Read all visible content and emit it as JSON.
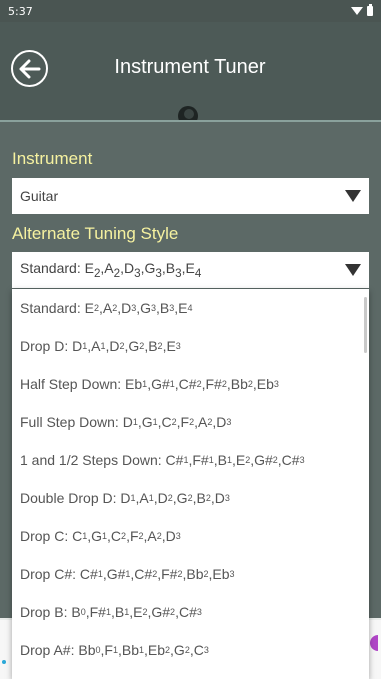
{
  "status_bar": {
    "time": "5:37"
  },
  "app_bar": {
    "title": "Instrument Tuner"
  },
  "instrument": {
    "label": "Instrument",
    "selected": "Guitar"
  },
  "tuning": {
    "label": "Alternate Tuning Style",
    "selected_html": "Standard: E<sub>2</sub>,A<sub>2</sub>,D<sub>3</sub>,G<sub>3</sub>,B<sub>3</sub>,E<sub>4</sub>",
    "options": [
      "Standard: E<sub>2</sub>,A<sub>2</sub>,D<sub>3</sub>,G<sub>3</sub>,B<sub>3</sub>,E<sub>4</sub>",
      "Drop D: D<sub>1</sub>,A<sub>1</sub>,D<sub>2</sub>,G<sub>2</sub>,B<sub>2</sub>,E<sub>3</sub>",
      "Half Step Down: Eb<sub>1</sub>,G#<sub>1</sub>,C#<sub>2</sub>,F#<sub>2</sub>,Bb<sub>2</sub>,Eb<sub>3</sub>",
      "Full Step Down: D<sub>1</sub>,G<sub>1</sub>,C<sub>2</sub>,F<sub>2</sub>,A<sub>2</sub>,D<sub>3</sub>",
      "1 and 1/2 Steps Down: C#<sub>1</sub>,F#<sub>1</sub>,B<sub>1</sub>,E<sub>2</sub>,G#<sub>2</sub>,C#<sub>3</sub>",
      "Double Drop D: D<sub>1</sub>,A<sub>1</sub>,D<sub>2</sub>,G<sub>2</sub>,B<sub>2</sub>,D<sub>3</sub>",
      "Drop C: C<sub>1</sub>,G<sub>1</sub>,C<sub>2</sub>,F<sub>2</sub>,A<sub>2</sub>,D<sub>3</sub>",
      "Drop C#: C#<sub>1</sub>,G#<sub>1</sub>,C#<sub>2</sub>,F#<sub>2</sub>,Bb<sub>2</sub>,Eb<sub>3</sub>",
      "Drop B: B<sub>0</sub>,F#<sub>1</sub>,B<sub>1</sub>,E<sub>2</sub>,G#<sub>2</sub>,C#<sub>3</sub>",
      "Drop A#: Bb<sub>0</sub>,F<sub>1</sub>,Bb<sub>1</sub>,Eb<sub>2</sub>,G<sub>2</sub>,C<sub>3</sub>"
    ]
  },
  "colors": {
    "app_bar": "#4d5a57",
    "background": "#5c6966",
    "label_yellow": "#f6f2a0"
  }
}
